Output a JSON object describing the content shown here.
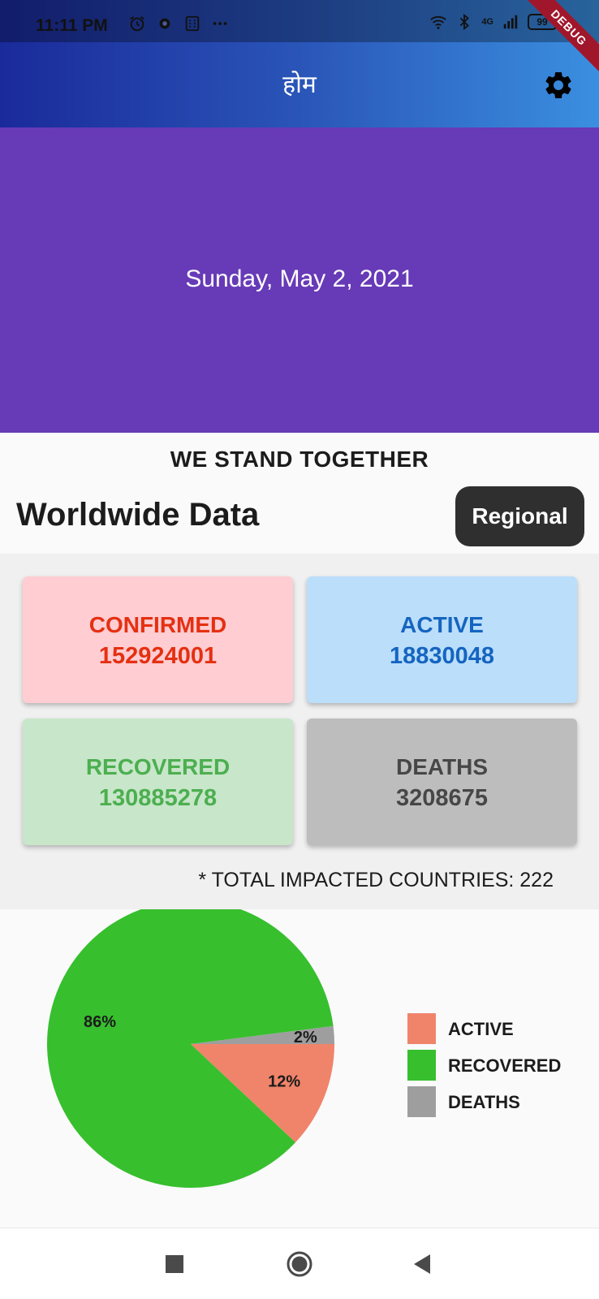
{
  "status_bar": {
    "time": "11:11 PM",
    "debug_label": "DEBUG",
    "network_label": "4G",
    "battery_level": "99"
  },
  "app_bar": {
    "title": "होम"
  },
  "hero": {
    "date": "Sunday, May 2, 2021"
  },
  "tagline": "WE STAND TOGETHER",
  "section": {
    "title": "Worldwide Data",
    "regional_button": "Regional"
  },
  "cards": {
    "confirmed": {
      "label": "CONFIRMED",
      "value": "152924001"
    },
    "active": {
      "label": "ACTIVE",
      "value": "18830048"
    },
    "recovered": {
      "label": "RECOVERED",
      "value": "130885278"
    },
    "deaths": {
      "label": "DEATHS",
      "value": "3208675"
    }
  },
  "impacted_countries": "* TOTAL IMPACTED COUNTRIES: 222",
  "chart_data": {
    "type": "pie",
    "slices": [
      {
        "name": "ACTIVE",
        "value": 12,
        "label": "12%",
        "color": "#f0846a"
      },
      {
        "name": "RECOVERED",
        "value": 86,
        "label": "86%",
        "color": "#37bf2e"
      },
      {
        "name": "DEATHS",
        "value": 2,
        "label": "2%",
        "color": "#9e9e9e"
      }
    ],
    "legend_placement": "right"
  },
  "colors": {
    "hero": "#673ab7",
    "confirmed": "#e53012",
    "active": "#1565c0",
    "recovered": "#4caf50",
    "deaths": "#474747"
  },
  "icons": {
    "settings": "gear-icon",
    "nav_recents": "square-icon",
    "nav_home": "circle-icon",
    "nav_back": "triangle-back-icon"
  }
}
